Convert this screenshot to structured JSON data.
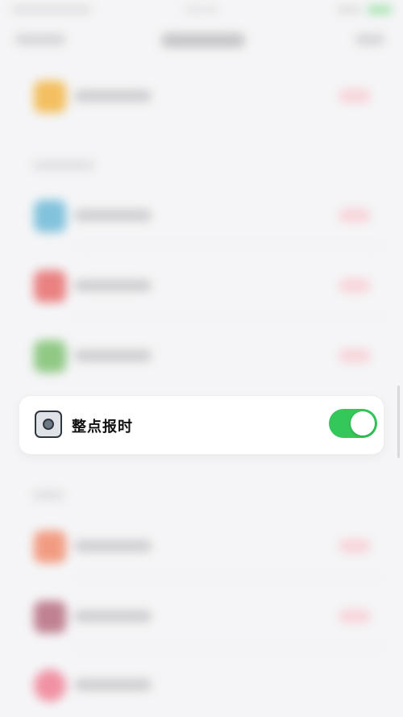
{
  "focused_item": {
    "label": "整点报时",
    "icon": "clock-chime-icon",
    "toggle": {
      "state": "on",
      "color": "#34c759"
    }
  },
  "background": {
    "blurred": true,
    "rows": [
      {
        "icon_color": "#f2b441"
      },
      {
        "icon_color": "#6ab8d6"
      },
      {
        "icon_color": "#e86a6a"
      },
      {
        "icon_color": "#7bbf6e"
      },
      {
        "icon_color": "#f08a6a"
      },
      {
        "icon_color": "#b56a7d"
      },
      {
        "icon_color": "#ef7e93"
      }
    ]
  }
}
